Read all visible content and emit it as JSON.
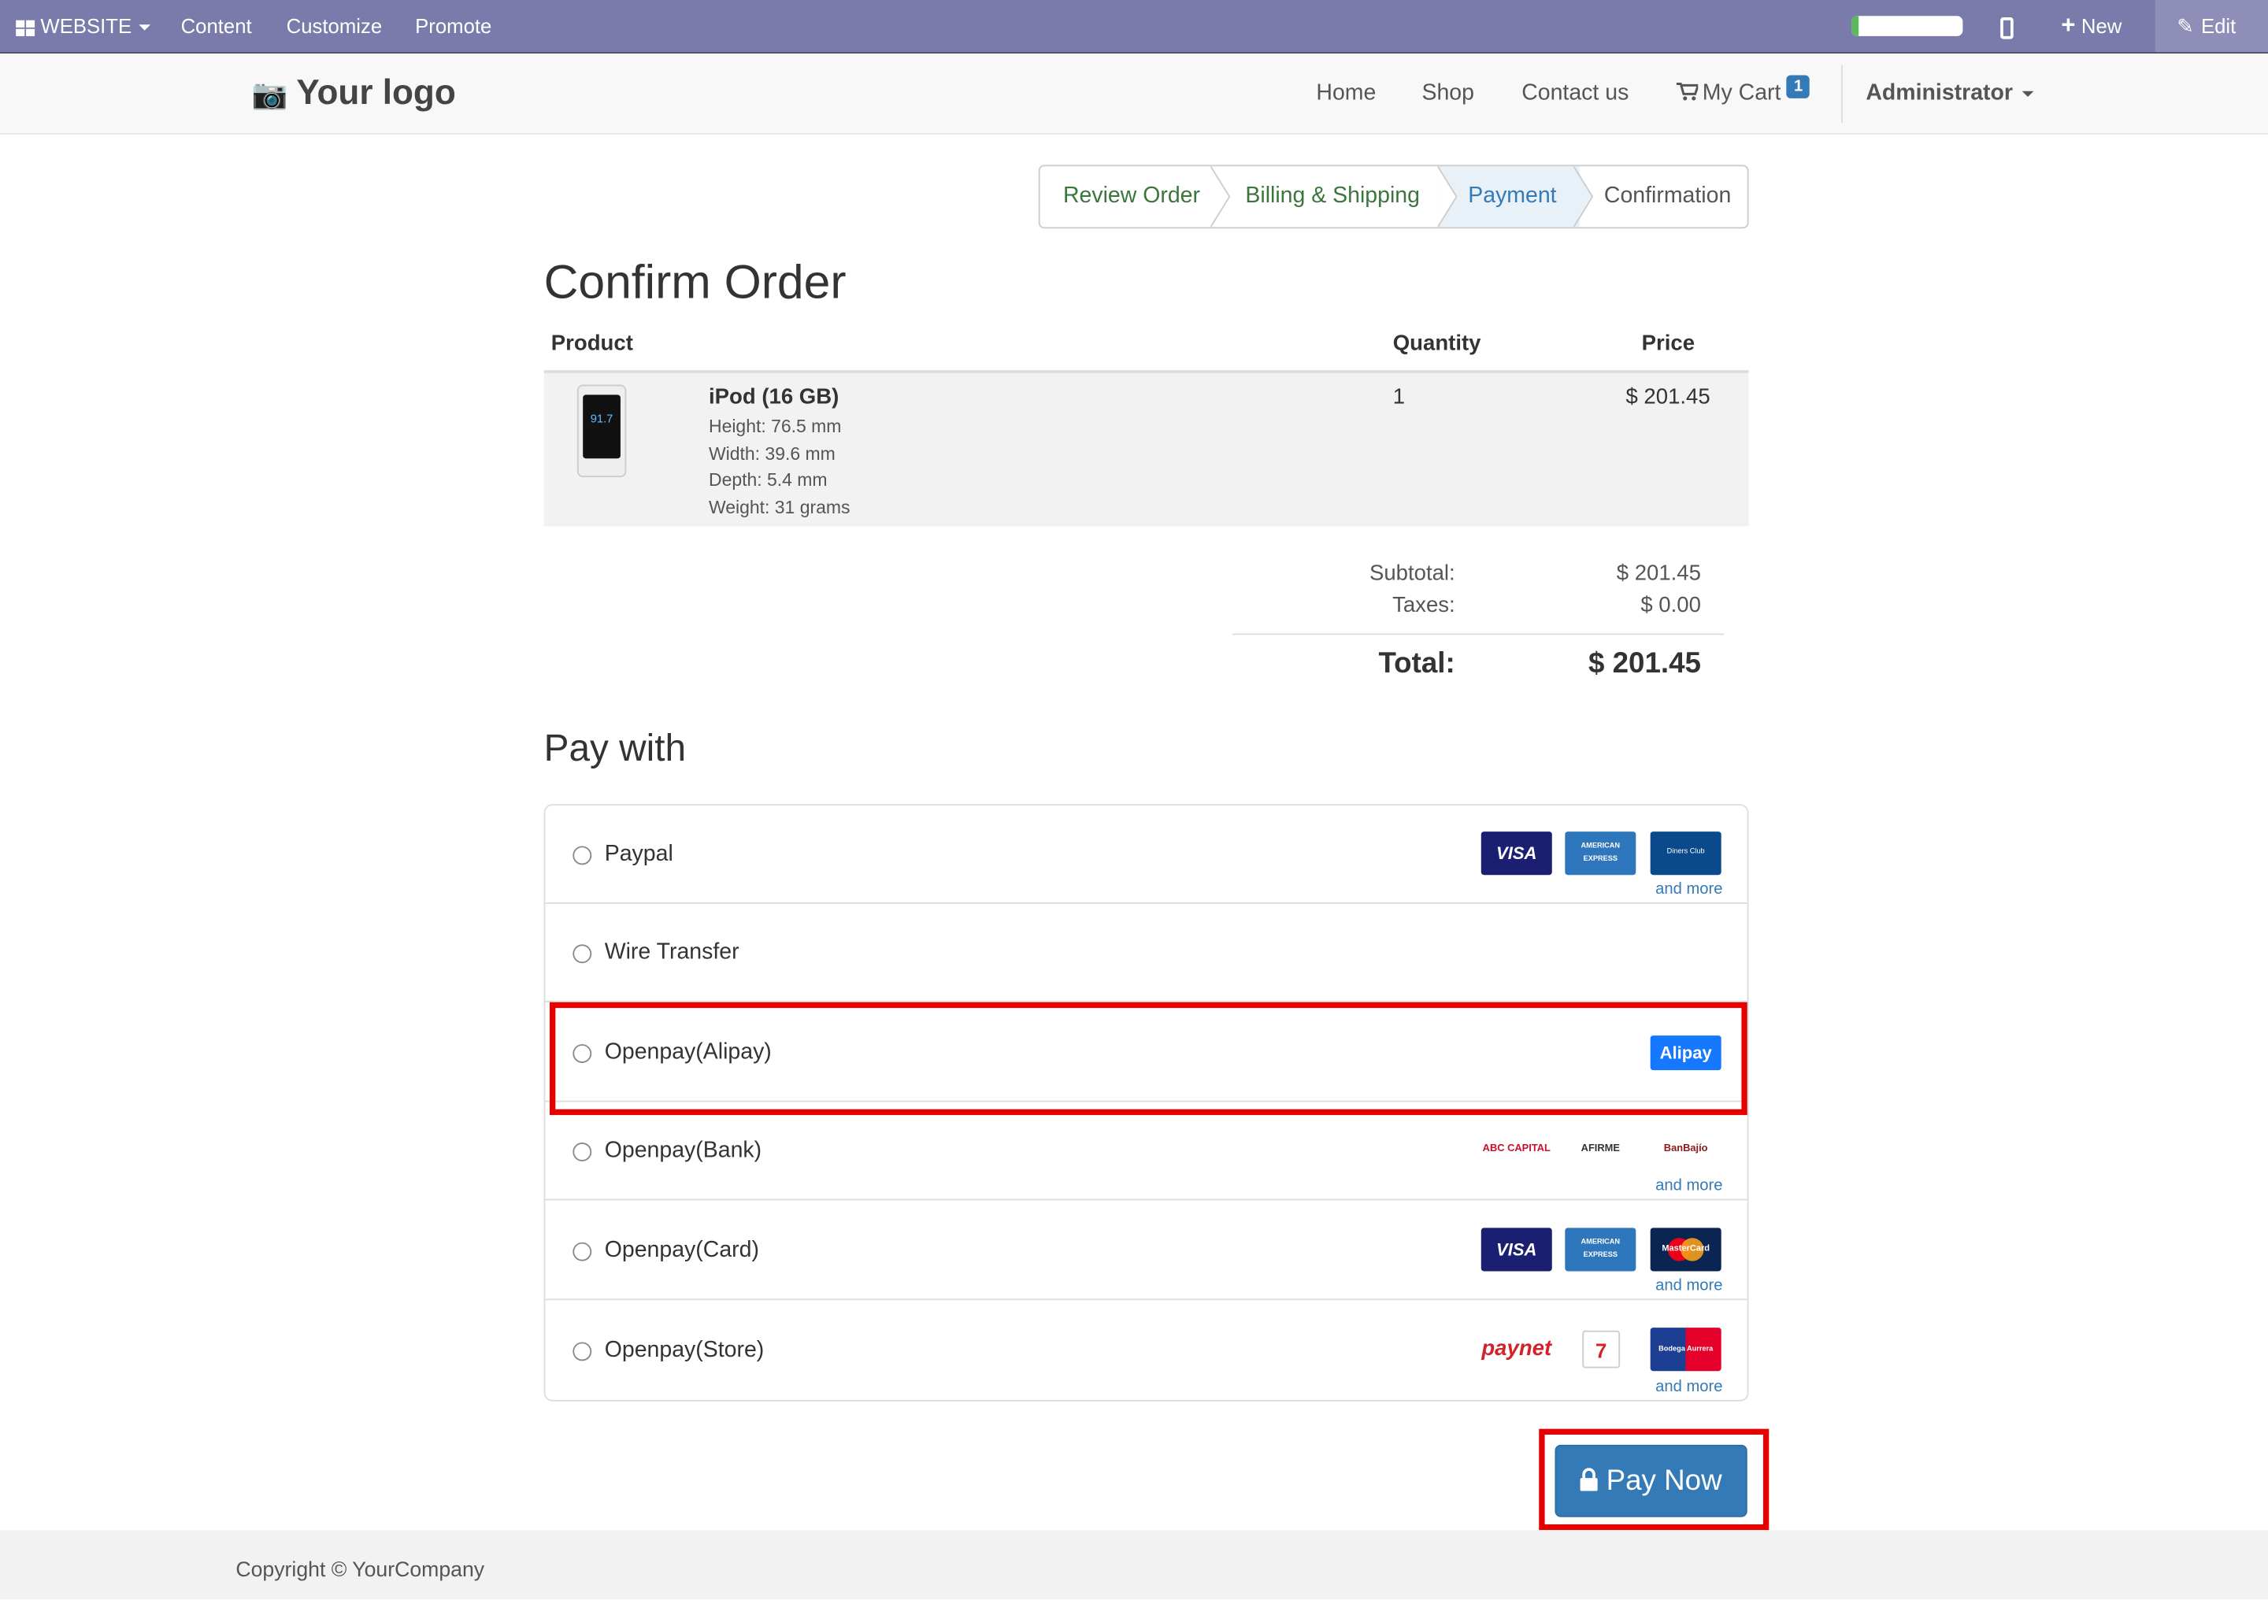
{
  "admin_bar": {
    "website": "WEBSITE",
    "content": "Content",
    "customize": "Customize",
    "promote": "Promote",
    "new": "New",
    "edit": "Edit"
  },
  "navbar": {
    "logo": "Your logo",
    "home": "Home",
    "shop": "Shop",
    "contact": "Contact us",
    "cart": "My Cart",
    "cart_count": "1",
    "user": "Administrator"
  },
  "wizard": {
    "steps": [
      "Review Order",
      "Billing & Shipping",
      "Payment",
      "Confirmation"
    ],
    "active": "Payment"
  },
  "order": {
    "title": "Confirm Order",
    "col_product": "Product",
    "col_quantity": "Quantity",
    "col_price": "Price",
    "product_name": "iPod (16 GB)",
    "product_screen": "91.7",
    "details": [
      "Height: 76.5 mm",
      "Width: 39.6 mm",
      "Depth: 5.4 mm",
      "Weight: 31 grams"
    ],
    "quantity": "1",
    "price": "$ 201.45",
    "subtotal_label": "Subtotal:",
    "subtotal": "$ 201.45",
    "taxes_label": "Taxes:",
    "taxes": "$ 0.00",
    "total_label": "Total:",
    "total": "$ 201.45"
  },
  "payment": {
    "title": "Pay with",
    "and_more": "and more",
    "methods": [
      {
        "label": "Paypal",
        "icons": [
          "VISA",
          "AMERICAN EXPRESS",
          "Diners Club"
        ]
      },
      {
        "label": "Wire Transfer",
        "icons": []
      },
      {
        "label": "Openpay(Alipay)",
        "icons": [
          "Alipay"
        ]
      },
      {
        "label": "Openpay(Bank)",
        "icons": [
          "ABC CAPITAL",
          "AFIRME",
          "BanBajío"
        ]
      },
      {
        "label": "Openpay(Card)",
        "icons": [
          "VISA",
          "AMERICAN EXPRESS",
          "MasterCard"
        ]
      },
      {
        "label": "Openpay(Store)",
        "icons": [
          "paynet",
          "7",
          "Bodega Aurrera"
        ]
      }
    ],
    "pay_button": "Pay Now"
  },
  "footer": {
    "copyright": "Copyright © YourCompany"
  },
  "colors": {
    "admin_bar": "#7b7bab",
    "primary": "#337ab7",
    "highlight": "#e60000",
    "done_step": "#3c763d"
  }
}
